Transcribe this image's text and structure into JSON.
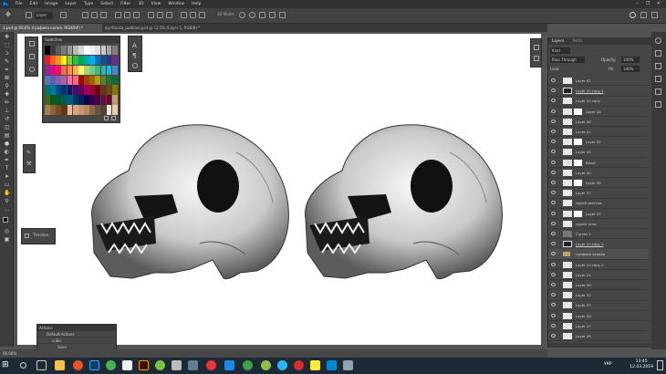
{
  "app": {
    "logo": "Ps"
  },
  "menu": [
    "File",
    "Edit",
    "Image",
    "Layer",
    "Type",
    "Select",
    "Filter",
    "3D",
    "View",
    "Window",
    "Help"
  ],
  "window_controls": [
    "–",
    "❐",
    "✕"
  ],
  "options_bar": {
    "auto_select": "Layer",
    "mode_3d": "3D Mode:"
  },
  "tabs": [
    {
      "label": "3.psd @ 66,6% (графика копия, RGB/8#) *",
      "active": true
    },
    {
      "label": "футболка_шаблон.psd @ 12,5% (Layer 1, RGB/8) *",
      "active": false
    }
  ],
  "swatches": {
    "title": "Swatches",
    "colors": [
      "#000000",
      "#3c3c3c",
      "#5a5a5a",
      "#7a7a7a",
      "#9a9a9a",
      "#b9b9b9",
      "#d6d6d6",
      "#ffffff",
      "#f1f1f1",
      "#e0e0e0",
      "#c8c8c8",
      "#a5a5a5",
      "#808080",
      "#ed1c24",
      "#f26522",
      "#f7941d",
      "#fff200",
      "#8dc63f",
      "#39b54a",
      "#00a651",
      "#00a99d",
      "#00aeef",
      "#0072bc",
      "#0054a6",
      "#2e3192",
      "#662d91",
      "#92278f",
      "#ec008c",
      "#ed145b",
      "#f26c4f",
      "#f68e55",
      "#fbaf5d",
      "#fff568",
      "#acd373",
      "#7cc576",
      "#3bb878",
      "#1abbb4",
      "#00bff3",
      "#438ccb",
      "#5574b9",
      "#605ca8",
      "#855fa8",
      "#a763a8",
      "#f06eaa",
      "#f26d7d",
      "#9e0b0f",
      "#a0410d",
      "#a3620a",
      "#aba000",
      "#598527",
      "#197b30",
      "#007236",
      "#00746b",
      "#0076a3",
      "#004a80",
      "#003471",
      "#1b1464",
      "#440e62",
      "#630460",
      "#9e005d",
      "#9e0039",
      "#790000",
      "#7b2e00",
      "#7d4900",
      "#827b00",
      "#406618",
      "#005e20",
      "#005826",
      "#005952",
      "#005b7f",
      "#003663",
      "#002157",
      "#0d004c",
      "#32004b",
      "#4b0049",
      "#7b0046",
      "#7a0026",
      "#c69c6d",
      "#a67c52",
      "#8c6239",
      "#754c24",
      "#603913",
      "#e6b7a1",
      "#d2a682",
      "#c6956b",
      "#b38a60",
      "#8a6a47",
      "#6a523a",
      "#51412f",
      "#f6e8d8",
      "#e9cfb1"
    ]
  },
  "timeline": {
    "title": "Timeline"
  },
  "actions": {
    "title": "Actions",
    "items": [
      {
        "label": "Default Actions",
        "indent": 0
      },
      {
        "label": "cubic",
        "indent": 1
      },
      {
        "label": "Save",
        "indent": 2
      }
    ]
  },
  "statusbar": {
    "zoom": "66,66%"
  },
  "layers_panel": {
    "tabs": [
      "Layers",
      "Paths"
    ],
    "kind": "Kind",
    "blend": "Pass Through",
    "opacity_label": "Opacity:",
    "opacity": "100%",
    "lock_label": "Lock:",
    "fill_label": "Fill:",
    "fill": "100%",
    "layers": [
      {
        "name": "Layer 42",
        "type": "pixel"
      },
      {
        "name": "Layer 10 copy 4",
        "type": "special"
      },
      {
        "name": "Layer 10 copy",
        "type": "pixel"
      },
      {
        "name": "Layer 44",
        "type": "mask"
      },
      {
        "name": "Layer 46",
        "type": "pixel"
      },
      {
        "name": "Layer 41",
        "type": "pixel"
      },
      {
        "name": "Layer 42",
        "type": "mask"
      },
      {
        "name": "Layer 43",
        "type": "pixel"
      },
      {
        "name": "Bevel",
        "type": "mask"
      },
      {
        "name": "Layer 40",
        "type": "pixel"
      },
      {
        "name": "Layer 38",
        "type": "mask"
      },
      {
        "name": "Layer 37",
        "type": "pixel"
      },
      {
        "name": "пруей светсов",
        "type": "pixel"
      },
      {
        "name": "Layer 47",
        "type": "mask"
      },
      {
        "name": "пруей тени",
        "type": "pixel"
      },
      {
        "name": "Curves 1",
        "type": "adjust"
      },
      {
        "name": "Layer 10 copy 3",
        "type": "special"
      },
      {
        "name": "графика основа",
        "type": "group"
      },
      {
        "name": "Layer 10 copy 2",
        "type": "pixel"
      },
      {
        "name": "Layer 24",
        "type": "pixel"
      },
      {
        "name": "Layer 36",
        "type": "pixel"
      },
      {
        "name": "Layer 32",
        "type": "pixel"
      },
      {
        "name": "Layer 33",
        "type": "pixel"
      },
      {
        "name": "Layer 28",
        "type": "pixel"
      },
      {
        "name": "Layer 27",
        "type": "pixel"
      },
      {
        "name": "Layer 26",
        "type": "pixel"
      }
    ]
  },
  "taskbar": {
    "lang": "УКР",
    "time": "13:45",
    "date": "12.03.2019"
  }
}
